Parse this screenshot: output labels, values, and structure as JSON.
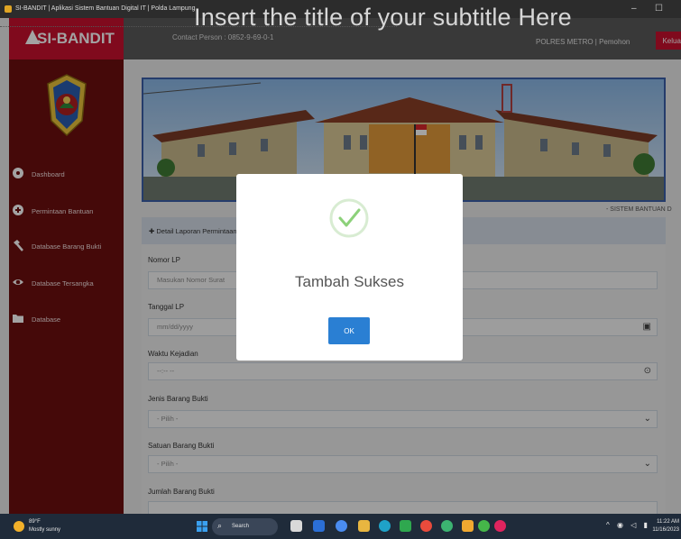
{
  "slide": {
    "title": "Insert the title of your subtitle Here"
  },
  "window": {
    "title": "SI-BANDIT | Aplikasi Sistem Bantuan Digital IT | Polda Lampung",
    "minimize": "–",
    "maximize": "☐"
  },
  "brand": {
    "name": "SI-BANDIT"
  },
  "sidebar": {
    "items": [
      {
        "label": "Dashboard",
        "icon": "dashboard-icon"
      },
      {
        "label": "Permintaan Bantuan",
        "icon": "add-circle-icon"
      },
      {
        "label": "Database Barang Bukti",
        "icon": "gavel-icon"
      },
      {
        "label": "Database Tersangka",
        "icon": "eye-icon"
      },
      {
        "label": "Database",
        "icon": "folder-icon"
      }
    ]
  },
  "topbar": {
    "contact": "Contact Person : 0852-9-69-0-1",
    "user": "POLRES METRO | Pemohon",
    "logout": "Keluar"
  },
  "banner": {
    "marquee": "- SISTEM BANTUAN D"
  },
  "panel": {
    "title": "Detail Laporan Permintaan"
  },
  "form": {
    "fields": [
      {
        "label": "Nomor LP",
        "placeholder": "Masukan Nomor Surat",
        "icon": ""
      },
      {
        "label": "Tanggal LP",
        "placeholder": "mm/dd/yyyy",
        "icon": "calendar-icon"
      },
      {
        "label": "Waktu Kejadian",
        "placeholder": "--:-- --",
        "icon": "clock-icon"
      },
      {
        "label": "Jenis Barang Bukti",
        "placeholder": "- Pilih -",
        "icon": "chevron-down-icon"
      },
      {
        "label": "Satuan Barang Bukti",
        "placeholder": "- Pilih -",
        "icon": "chevron-down-icon"
      },
      {
        "label": "Jumlah Barang Bukti",
        "placeholder": "",
        "icon": ""
      }
    ]
  },
  "modal": {
    "title": "Tambah Sukses",
    "ok": "OK",
    "accent": "#8cd17a"
  },
  "taskbar": {
    "weather_temp": "89°F",
    "weather_desc": "Mostly sunny",
    "search": "Search",
    "time": "11:22 AM",
    "date": "11/16/2023"
  },
  "colors": {
    "brand": "#c8102e",
    "sidebar": "#6d0f0f",
    "ok": "#2a7fd3"
  }
}
